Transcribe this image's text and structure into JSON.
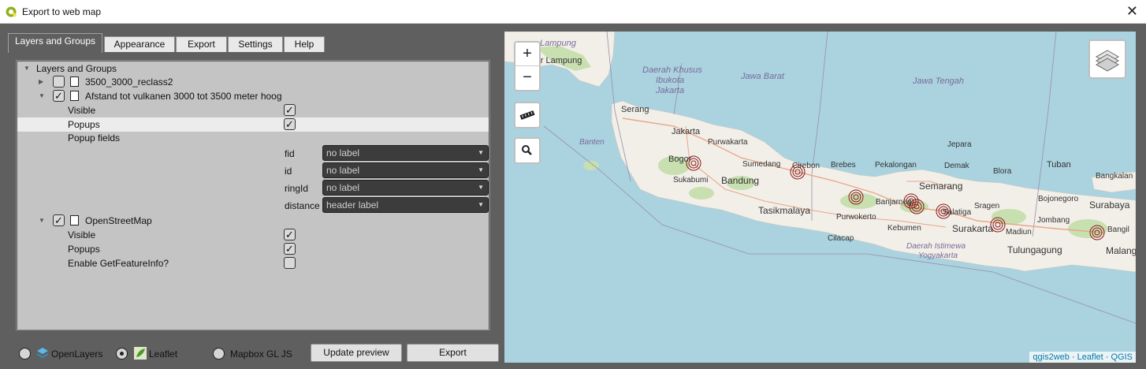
{
  "window": {
    "title": "Export to web map",
    "close_glyph": "✕"
  },
  "tabs": [
    "Layers and Groups",
    "Appearance",
    "Export",
    "Settings",
    "Help"
  ],
  "tree": {
    "root_label": "Layers and Groups",
    "layer1": {
      "name": "3500_3000_reclass2",
      "checked": false
    },
    "layer2": {
      "name": "Afstand tot vulkanen 3000 tot 3500 meter hoog",
      "checked": true,
      "visible_label": "Visible",
      "popups_label": "Popups",
      "popup_fields_label": "Popup fields",
      "fields": [
        {
          "name": "fid",
          "value": "no label"
        },
        {
          "name": "id",
          "value": "no label"
        },
        {
          "name": "ringId",
          "value": "no label"
        },
        {
          "name": "distance",
          "value": "header label"
        }
      ]
    },
    "layer3": {
      "name": "OpenStreetMap",
      "checked": true,
      "visible_label": "Visible",
      "popups_label": "Popups",
      "getfeatureinfo_label": "Enable GetFeatureInfo?"
    }
  },
  "bottom": {
    "openlayers_label": "OpenLayers",
    "leaflet_label": "Leaflet",
    "mapbox_label": "Mapbox GL JS",
    "update_preview_label": "Update preview",
    "export_label": "Export"
  },
  "map": {
    "attribution": {
      "qgis2web": "qgis2web",
      "leaflet": "Leaflet",
      "qgis": "QGIS",
      "sep": " · "
    },
    "labels": {
      "lampung": "Lampung",
      "bandar_lampung": "Bandar Lampung",
      "daerah_khusus": "Daerah Khusus",
      "ibukota": "Ibukota",
      "jakarta_prov": "Jakarta",
      "jawa_barat": "Jawa Barat",
      "jawa_tengah": "Jawa Tengah",
      "serang": "Serang",
      "jakarta": "Jakarta",
      "purwakarta": "Purwakarta",
      "banten": "Banten",
      "bogor": "Bogor",
      "sumedang": "Sumedang",
      "cirebon": "Cirebon",
      "brebes": "Brebes",
      "pekalongan": "Pekalongan",
      "jepara": "Jepara",
      "demak": "Demak",
      "blora": "Blora",
      "tuban": "Tuban",
      "bangkalan": "Bangkalan",
      "sukabumi": "Sukabumi",
      "bandung": "Bandung",
      "semarang": "Semarang",
      "tasikmalaya": "Tasikmalaya",
      "banjarnegara": "Banjarneg",
      "sragen": "Sragen",
      "bojonegoro": "Bojonegoro",
      "surabaya": "Surabaya",
      "purwokerto": "Purwokerto",
      "salatiga": "Salatiga",
      "jombang": "Jombang",
      "kebumen": "Kebumen",
      "surakarta": "Surakarta",
      "madiun": "Madiun",
      "cilacap": "Cilacap",
      "daerah_istimewa": "Daerah Istimewa",
      "yogyakarta": "Yogyakarta",
      "tulungagung": "Tulungagung",
      "malang": "Malang",
      "bangil": "Bangil"
    },
    "zoom_in": "+",
    "zoom_out": "−",
    "colors": {
      "water": "#aad3df",
      "land": "#f2efe9",
      "forest": "#b6d39a",
      "rings": "#8b1a1a"
    }
  }
}
